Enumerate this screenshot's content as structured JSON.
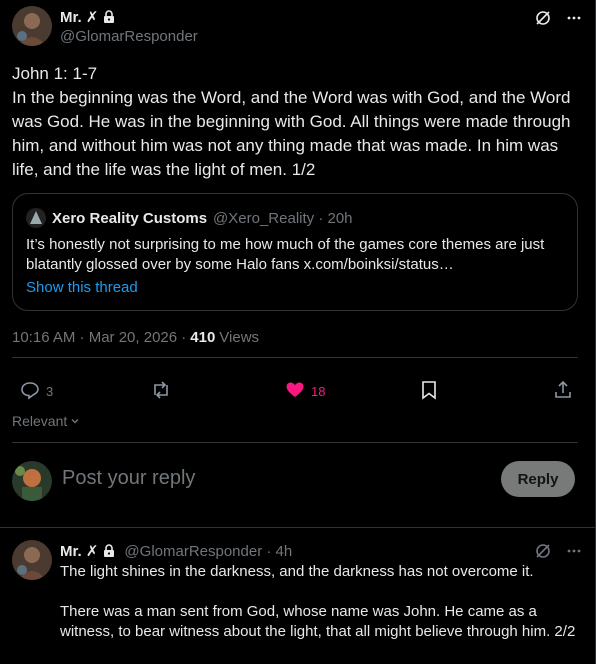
{
  "main_tweet": {
    "display_name": "Mr. ✗",
    "handle": "@GlomarResponder",
    "text": "John 1: 1-7\nIn the beginning was the Word, and the Word was with God, and the Word was God. He was in the beginning with God. All things were made through him, and without him was not any thing made that was made. In him was life, and the life was the light of men. 1/2",
    "timestamp": "10:16 AM · Mar 20, 2026 ·",
    "views_count": "410",
    "views_label": "Views"
  },
  "quote": {
    "display_name": "Xero Reality Customs",
    "meta": "@Xero_Reality · 20h",
    "text": "It’s honestly not surprising to me how much of the games core themes are just blatantly glossed over by some Halo fans x.com/boinksi/status…",
    "thread_link": "Show this thread"
  },
  "actions": {
    "reply_count": "3",
    "retweet_count": "",
    "like_count": "18",
    "like_color": "#f91880"
  },
  "sort": {
    "label": "Relevant"
  },
  "compose": {
    "placeholder": "Post your reply",
    "reply_button": "Reply"
  },
  "reply_tweet": {
    "display_name": "Mr. ✗",
    "meta": "@GlomarResponder · 4h",
    "text": "The light shines in the darkness, and the darkness has not overcome it.\n\nThere was a man sent from God, whose name was John. He came as a witness, to bear witness about the light, that all might believe through him. 2/2"
  },
  "icons": [
    "lock-icon",
    "grok-icon",
    "more-icon",
    "reply-icon",
    "retweet-icon",
    "like-icon",
    "bookmark-icon",
    "share-icon",
    "chevron-down-icon"
  ]
}
